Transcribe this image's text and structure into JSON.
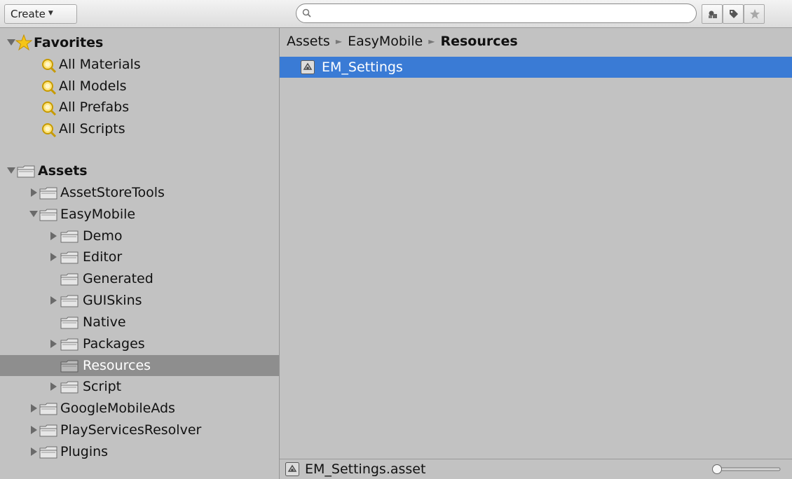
{
  "toolbar": {
    "create_label": "Create",
    "search_value": ""
  },
  "favorites": {
    "title": "Favorites",
    "items": [
      "All Materials",
      "All Models",
      "All Prefabs",
      "All Scripts"
    ]
  },
  "tree": {
    "root": "Assets",
    "items": [
      {
        "label": "AssetStoreTools"
      },
      {
        "label": "EasyMobile"
      },
      {
        "label": "Demo"
      },
      {
        "label": "Editor"
      },
      {
        "label": "Generated"
      },
      {
        "label": "GUISkins"
      },
      {
        "label": "Native"
      },
      {
        "label": "Packages"
      },
      {
        "label": "Resources"
      },
      {
        "label": "Script"
      },
      {
        "label": "GoogleMobileAds"
      },
      {
        "label": "PlayServicesResolver"
      },
      {
        "label": "Plugins"
      }
    ]
  },
  "breadcrumb": [
    "Assets",
    "EasyMobile",
    "Resources"
  ],
  "assets": [
    {
      "name": "EM_Settings",
      "icon": "scriptable-object-icon"
    }
  ],
  "status": {
    "selected_path": "EM_Settings.asset"
  },
  "colors": {
    "selection": "#3a7bd5",
    "tree_selection": "#8e8e8e",
    "panel": "#c2c2c2"
  }
}
